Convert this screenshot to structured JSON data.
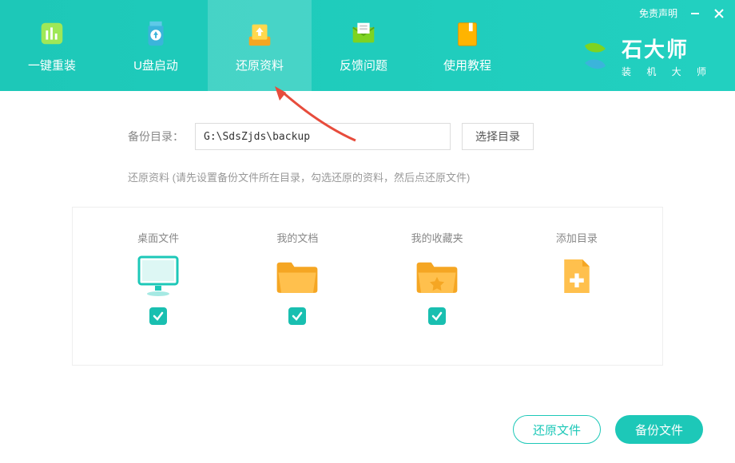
{
  "topRight": {
    "disclaimer": "免责声明"
  },
  "brand": {
    "title": "石大师",
    "sub": "装 机 大 师"
  },
  "nav": [
    {
      "label": "一键重装"
    },
    {
      "label": "U盘启动"
    },
    {
      "label": "还原资料"
    },
    {
      "label": "反馈问题"
    },
    {
      "label": "使用教程"
    }
  ],
  "backup": {
    "label": "备份目录：",
    "value": "G:\\SdsZjds\\backup",
    "selectBtn": "选择目录"
  },
  "hint": "还原资料 (请先设置备份文件所在目录，勾选还原的资料，然后点还原文件)",
  "items": [
    {
      "label": "桌面文件"
    },
    {
      "label": "我的文档"
    },
    {
      "label": "我的收藏夹"
    },
    {
      "label": "添加目录"
    }
  ],
  "footer": {
    "restore": "还原文件",
    "backup": "备份文件"
  }
}
